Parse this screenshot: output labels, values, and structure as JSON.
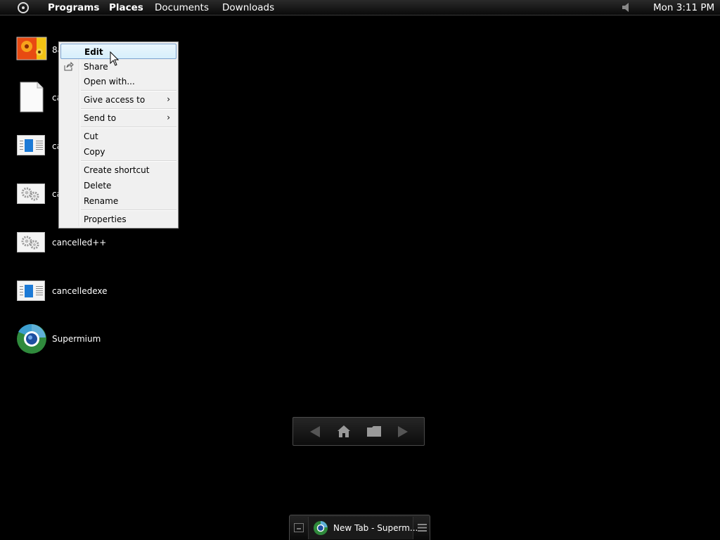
{
  "topbar": {
    "menu": [
      "Programs",
      "Places",
      "Documents",
      "Downloads"
    ],
    "clock": "Mon 3:11 PM"
  },
  "desktop": {
    "icons": [
      {
        "label": "8a",
        "kind": "image"
      },
      {
        "label": "ca",
        "kind": "file"
      },
      {
        "label": "ca",
        "kind": "document"
      },
      {
        "label": "ca",
        "kind": "settings"
      },
      {
        "label": "cancelled++",
        "kind": "settings"
      },
      {
        "label": "cancelledexe",
        "kind": "document"
      },
      {
        "label": "Supermium",
        "kind": "browser"
      }
    ]
  },
  "context_menu": {
    "items": [
      {
        "label": "Edit",
        "highlighted": true,
        "bold": true
      },
      {
        "label": "Share",
        "icon": "share-icon"
      },
      {
        "label": "Open with..."
      },
      {
        "label": "Give access to",
        "submenu": true
      },
      {
        "label": "Send to",
        "submenu": true
      },
      {
        "label": "Cut"
      },
      {
        "label": "Copy"
      },
      {
        "label": "Create shortcut"
      },
      {
        "label": "Delete"
      },
      {
        "label": "Rename"
      },
      {
        "label": "Properties"
      }
    ]
  },
  "taskbar": {
    "task_label": "New Tab - Superm..."
  }
}
